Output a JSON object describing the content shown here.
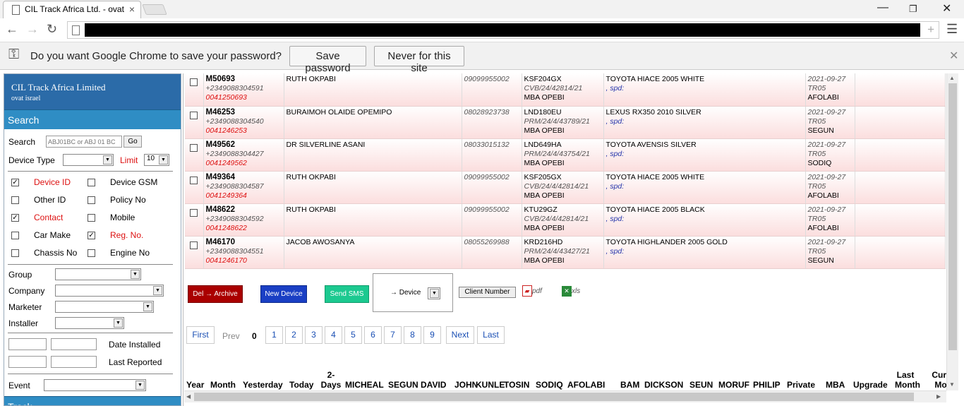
{
  "browser": {
    "tab_title": "CIL Track Africa Ltd. - ovat",
    "tab_close": "×",
    "new_tab": "+",
    "password_prompt": "Do you want Google Chrome to save your password?",
    "save_password": "Save password",
    "never_for_site": "Never for this site"
  },
  "sidebar": {
    "company": "CIL Track Africa Limited",
    "user": "ovat israel",
    "section_search": "Search",
    "search_label": "Search",
    "search_placeholder": "ABJ01BC or ABJ 01 BC",
    "go": "Go",
    "device_type_label": "Device Type",
    "limit_label": "Limit",
    "limit_value": "10",
    "fields": [
      {
        "label": "Device ID",
        "checked": true,
        "red": true
      },
      {
        "label": "Device GSM",
        "checked": false,
        "red": false
      },
      {
        "label": "Other ID",
        "checked": false,
        "red": false
      },
      {
        "label": "Policy No",
        "checked": false,
        "red": false
      },
      {
        "label": "Contact",
        "checked": true,
        "red": true
      },
      {
        "label": "Mobile",
        "checked": false,
        "red": false
      },
      {
        "label": "Car Make",
        "checked": false,
        "red": false
      },
      {
        "label": "Reg. No.",
        "checked": true,
        "red": true
      },
      {
        "label": "Chassis No",
        "checked": false,
        "red": false
      },
      {
        "label": "Engine No",
        "checked": false,
        "red": false
      }
    ],
    "group": "Group",
    "company_label": "Company",
    "marketer": "Marketer",
    "installer": "Installer",
    "date_installed": "Date Installed",
    "last_reported": "Last Reported",
    "event": "Event",
    "next_section": "Track"
  },
  "rows": [
    {
      "id": "M50693",
      "phone": "+2349088304591",
      "sim": "0041250693",
      "name": "RUTH OKPABI",
      "gsm": "09099955002",
      "reg": "KSF204GX",
      "policy": "CVB/24/42814/21",
      "branch": "MBA OPEBI",
      "car": "TOYOTA HIACE 2005 WHITE",
      "spd": ", spd:",
      "date": "2021-09-27",
      "code": "TR05",
      "installer": "AFOLABI"
    },
    {
      "id": "M46253",
      "phone": "+2349088304540",
      "sim": "0041246253",
      "name": "BURAIMOH OLAIDE OPEMIPO",
      "gsm": "08028923738",
      "reg": "LND180EU",
      "policy": "PRM/24/4/43789/21",
      "branch": "MBA OPEBI",
      "car": "LEXUS RX350 2010 SILVER",
      "spd": ", spd:",
      "date": "2021-09-27",
      "code": "TR05",
      "installer": "SEGUN"
    },
    {
      "id": "M49562",
      "phone": "+2349088304427",
      "sim": "0041249562",
      "name": "DR SILVERLINE ASANI",
      "gsm": "08033015132",
      "reg": "LND649HA",
      "policy": "PRM/24/4/43754/21",
      "branch": "MBA OPEBI",
      "car": "TOYOTA AVENSIS SILVER",
      "spd": ", spd:",
      "date": "2021-09-27",
      "code": "TR05",
      "installer": "SODIQ"
    },
    {
      "id": "M49364",
      "phone": "+2349088304587",
      "sim": "0041249364",
      "name": "RUTH OKPABI",
      "gsm": "09099955002",
      "reg": "KSF205GX",
      "policy": "CVB/24/4/42814/21",
      "branch": "MBA OPEBI",
      "car": "TOYOTA HIACE 2005 WHITE",
      "spd": ", spd:",
      "date": "2021-09-27",
      "code": "TR05",
      "installer": "AFOLABI"
    },
    {
      "id": "M48622",
      "phone": "+2349088304592",
      "sim": "0041248622",
      "name": "RUTH OKPABI",
      "gsm": "09099955002",
      "reg": "KTU29GZ",
      "policy": "CVB/24/4/42814/21",
      "branch": "MBA OPEBI",
      "car": "TOYOTA HIACE 2005 BLACK",
      "spd": ", spd:",
      "date": "2021-09-27",
      "code": "TR05",
      "installer": "AFOLABI"
    },
    {
      "id": "M46170",
      "phone": "+2349088304551",
      "sim": "0041246170",
      "name": "JACOB AWOSANYA",
      "gsm": "08055269988",
      "reg": "KRD216HD",
      "policy": "PRM/24/4/43427/21",
      "branch": "MBA OPEBI",
      "car": "TOYOTA HIGHLANDER 2005 GOLD",
      "spd": ", spd:",
      "date": "2021-09-27",
      "code": "TR05",
      "installer": "SEGUN"
    }
  ],
  "actions": {
    "archive": "Del → Archive",
    "new_device": "New Device",
    "send_sms": "Send SMS",
    "device_select": "→ Device",
    "client_number": "Client Number",
    "pdf": "pdf",
    "xls": "xls"
  },
  "pager": {
    "first": "First",
    "prev": "Prev",
    "current": "0",
    "pages": [
      "1",
      "2",
      "3",
      "4",
      "5",
      "6",
      "7",
      "8",
      "9"
    ],
    "next": "Next",
    "last": "Last"
  },
  "columns": [
    "Year",
    "Month",
    "Yesterday",
    "Today",
    "2-Days",
    "MICHEAL",
    "SEGUN",
    "DAVID",
    "JOHN",
    "KUNLE",
    "TOSIN",
    "SODIQ",
    "AFOLABI",
    "BAM",
    "DICKSON",
    "SEUN",
    "MORUF",
    "PHILIP",
    "Private",
    "MBA",
    "Upgrade",
    "Last Month",
    "Curr Mo"
  ]
}
